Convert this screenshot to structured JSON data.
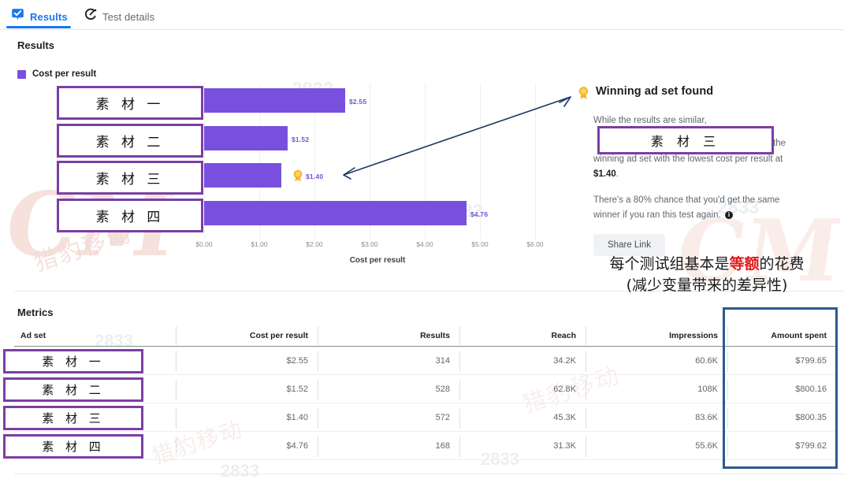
{
  "tabs": [
    {
      "label": "Results",
      "icon": "check-badge-icon",
      "active": true
    },
    {
      "label": "Test details",
      "icon": "gauge-icon",
      "active": false
    }
  ],
  "sections": {
    "results_title": "Results",
    "metrics_title": "Metrics"
  },
  "legend": {
    "label": "Cost per result",
    "color": "#7950dd"
  },
  "chart_data": {
    "type": "bar",
    "orientation": "horizontal",
    "title": "Results",
    "xlabel": "Cost per result",
    "ylabel": "",
    "categories": [
      "素 材 一",
      "素 材 二",
      "素 材 三",
      "素 材 四"
    ],
    "values": [
      2.55,
      1.52,
      1.4,
      4.76
    ],
    "value_labels": [
      "$2.55",
      "$1.52",
      "$1.40",
      "$4.76"
    ],
    "tick_labels": [
      "$0.00",
      "$1.00",
      "$2.00",
      "$3.00",
      "$4.00",
      "$5.00",
      "$6.00"
    ],
    "tick_values": [
      0,
      1,
      2,
      3,
      4,
      5,
      6
    ],
    "xlim": [
      0,
      6.4
    ],
    "grid": true,
    "legend": [
      "Cost per result"
    ],
    "series_color": "#7950dd",
    "winner_index": 2,
    "winner_badge": "award-ribbon-icon"
  },
  "winner": {
    "icon": "award-ribbon-icon",
    "title": "Winning ad set found",
    "line1": "While the results are similar,",
    "ad_set_name": "素 材 三",
    "after_box": "the",
    "line2": "winning ad set with the lowest cost per result at",
    "amount": "$1.40",
    "period": ".",
    "line3": "There's a 80% chance that you'd get the same",
    "line4": "winner if you ran this test again.",
    "info_icon": "info-icon",
    "share_button": "Share Link"
  },
  "annotation": {
    "line1_a": "每个测试组基本是",
    "line1_highlight": "等额",
    "line1_b": "的花费",
    "line2": "(减少变量带来的差异性)",
    "highlight_color": "#e01b1b",
    "arrow": "double-headed-arrow"
  },
  "table": {
    "columns": [
      "Ad set",
      "Cost per result",
      "Results",
      "Reach",
      "Impressions",
      "Amount spent"
    ],
    "rows": [
      {
        "ad_set": "素 材 一",
        "cost_per_result": "$2.55",
        "results": "314",
        "reach": "34.2K",
        "impressions": "60.6K",
        "amount_spent": "$799.65"
      },
      {
        "ad_set": "素 材 二",
        "cost_per_result": "$1.52",
        "results": "528",
        "reach": "62.8K",
        "impressions": "108K",
        "amount_spent": "$800.16"
      },
      {
        "ad_set": "素 材 三",
        "cost_per_result": "$1.40",
        "results": "572",
        "reach": "45.3K",
        "impressions": "83.6K",
        "amount_spent": "$800.35"
      },
      {
        "ad_set": "素 材 四",
        "cost_per_result": "$4.76",
        "results": "168",
        "reach": "31.3K",
        "impressions": "55.6K",
        "amount_spent": "$799.62"
      }
    ],
    "highlight_column": "Amount spent",
    "highlight_color": "#2d5a8e"
  },
  "watermarks": {
    "logo": "CM",
    "brand": "猎豹移动",
    "code": "2833"
  }
}
